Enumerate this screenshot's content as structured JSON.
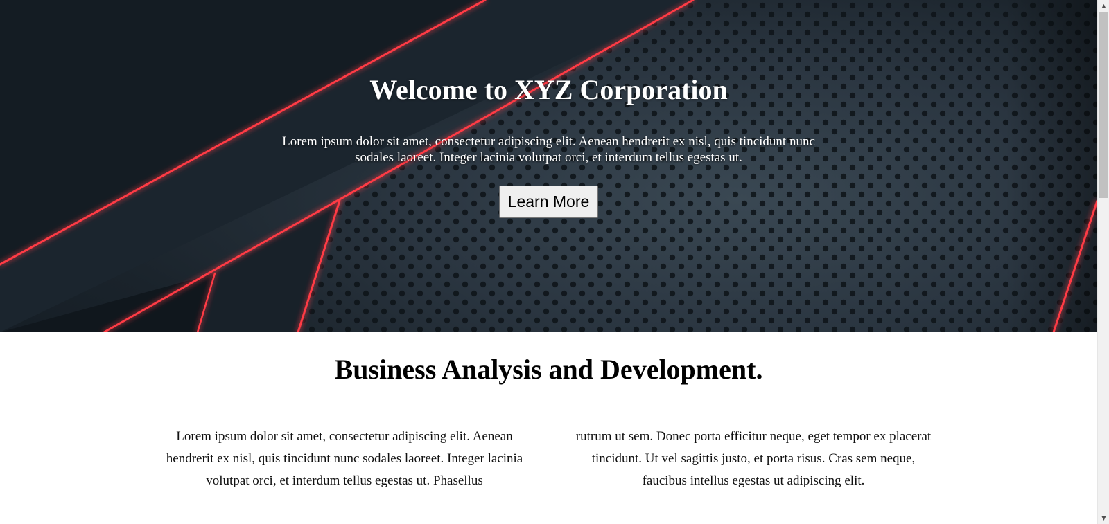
{
  "hero": {
    "title": "Welcome to XYZ Corporation",
    "text": "Lorem ipsum dolor sit amet, consectetur adipiscing elit. Aenean hendrerit ex nisl, quis tincidunt nunc sodales laoreet. Integer lacinia volutpat orci, et interdum tellus egestas ut.",
    "button_label": "Learn More"
  },
  "section": {
    "title": "Business Analysis and Development.",
    "col_left": "Lorem ipsum dolor sit amet, consectetur adipiscing elit. Aenean hendrerit ex nisl, quis tincidunt nunc sodales laoreet. Integer lacinia volutpat orci, et interdum tellus egestas ut. Phasellus",
    "col_right": "rutrum ut sem. Donec porta efficitur neque, eget tempor ex placerat tincidunt. Ut vel sagittis justo, et porta risus. Cras sem neque, faucibus intellus egestas ut adipiscing elit."
  },
  "colors": {
    "hero_dark": "#1a232b",
    "accent_red": "#ff3b45",
    "dot": "#0d1318"
  },
  "scrollbar": {
    "up_icon": "scroll-up-arrow-icon",
    "down_icon": "scroll-down-arrow-icon"
  }
}
